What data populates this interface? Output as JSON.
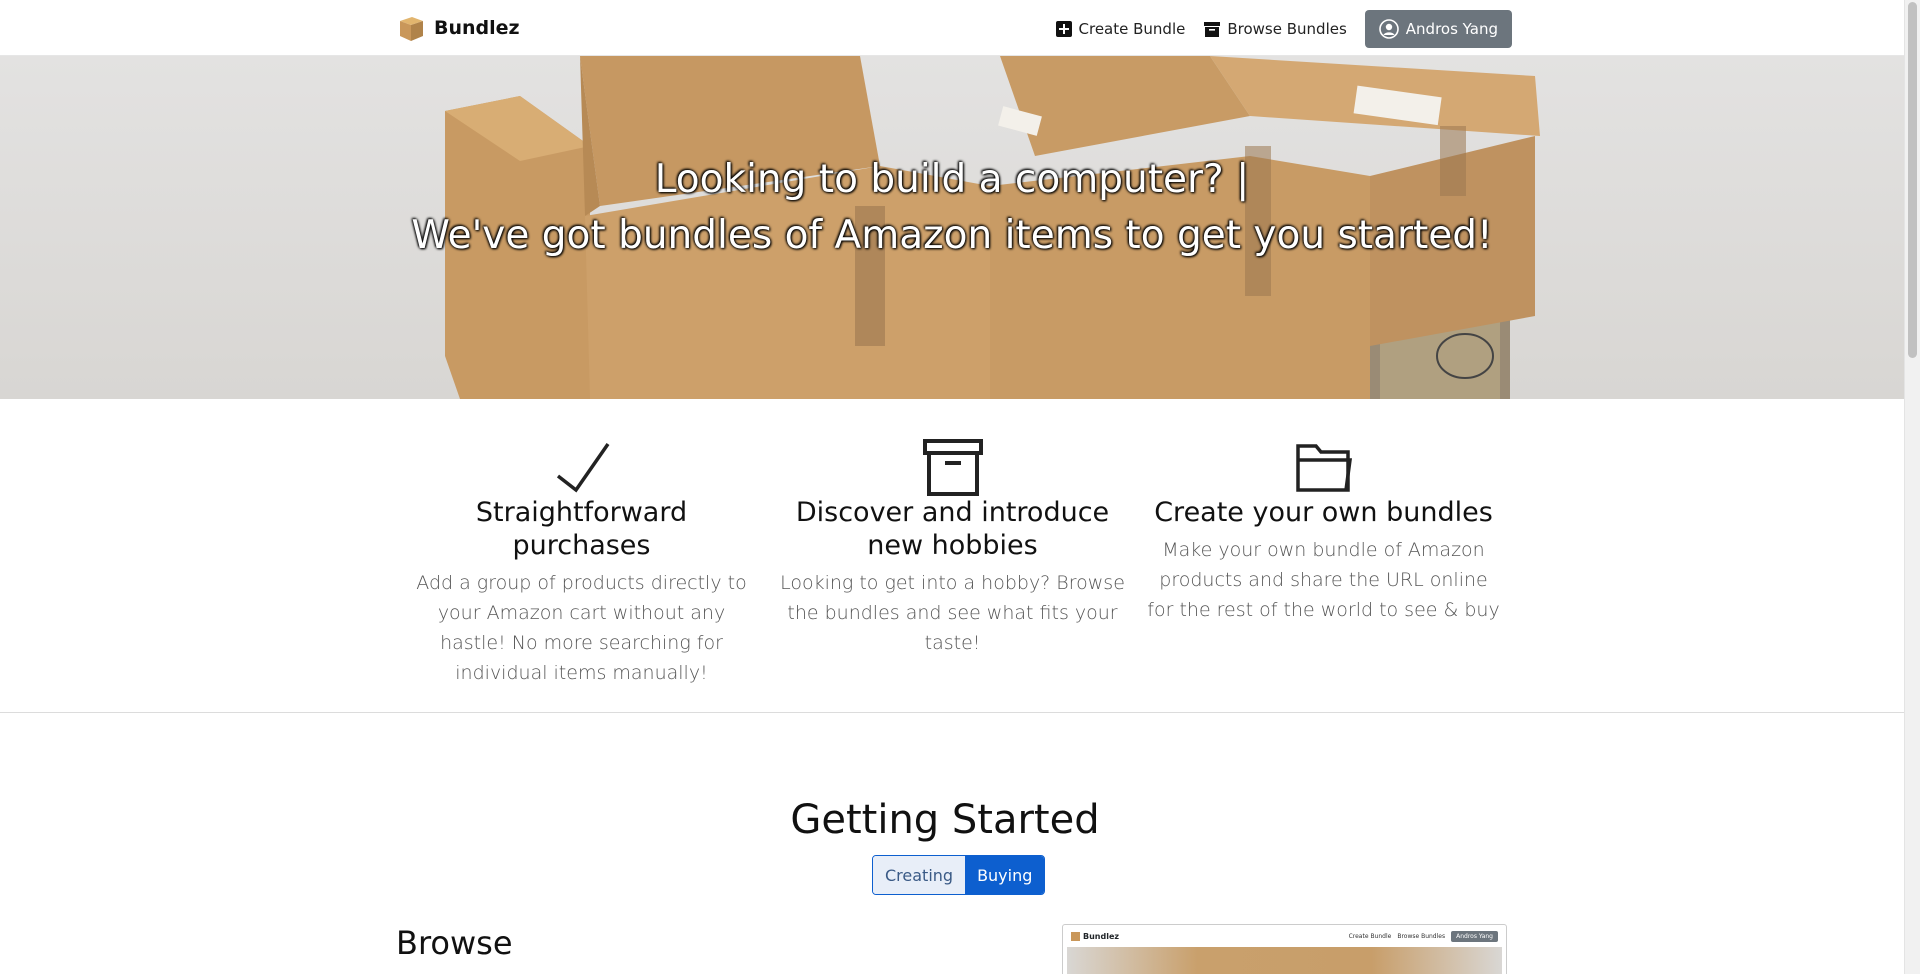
{
  "navbar": {
    "brand": "Bundlez",
    "links": [
      {
        "label": "Create Bundle",
        "icon": "plus-square-icon"
      },
      {
        "label": "Browse Bundles",
        "icon": "archive-icon"
      }
    ],
    "user": "Andros Yang"
  },
  "hero": {
    "line1": "Looking to build a computer? |",
    "line2": "We've got bundles of Amazon items to get you started!"
  },
  "features": [
    {
      "icon": "checkmark-icon",
      "title": "Straightforward purchases",
      "description": "Add a group of products directly to your Amazon cart without any hastle! No more searching for individual items manually!"
    },
    {
      "icon": "archive-box-icon",
      "title": "Discover and introduce new hobbies",
      "description": "Looking to get into a hobby? Browse the bundles and see what fits your taste!"
    },
    {
      "icon": "folder-icon",
      "title": "Create your own bundles",
      "description": "Make your own bundle of Amazon products and share the URL online for the rest of the world to see & buy"
    }
  ],
  "getting_started": {
    "title": "Getting Started",
    "toggle": [
      {
        "label": "Creating",
        "active": false
      },
      {
        "label": "Buying",
        "active": true
      }
    ],
    "section_heading": "Browse",
    "preview": {
      "brand": "Bundlez",
      "links": [
        "Create Bundle",
        "Browse Bundles"
      ],
      "user": "Andros Yang"
    }
  },
  "colors": {
    "accent": "#0d5fcf",
    "user_button": "#6c757d",
    "box_cardboard": "#c9975a"
  }
}
